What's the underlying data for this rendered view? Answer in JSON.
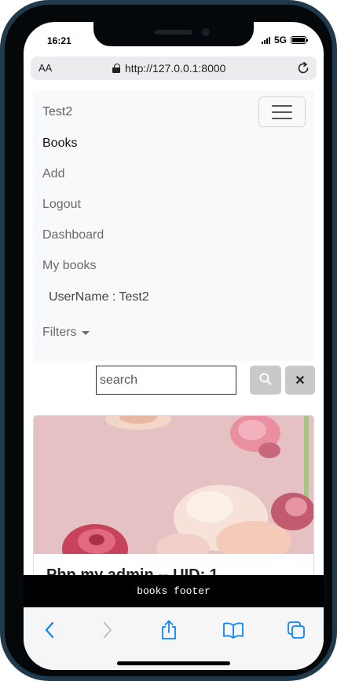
{
  "status_bar": {
    "time": "16:21",
    "network": "5G"
  },
  "browser": {
    "aa_label": "AA",
    "url": "http://127.0.0.1:8000"
  },
  "navbar": {
    "brand": "Test2",
    "links": [
      "Books",
      "Add",
      "Logout",
      "Dashboard",
      "My books"
    ],
    "username": "UserName : Test2",
    "filters_label": "Filters"
  },
  "search": {
    "placeholder": "search",
    "value": "",
    "clear_label": "✕"
  },
  "card": {
    "title": "Php my admin -- UID: 1"
  },
  "footer": {
    "text": "books footer"
  },
  "colors": {
    "accent": "#0a84ff",
    "footer_bg": "#000000",
    "button_gray": "#c9c9c9"
  }
}
